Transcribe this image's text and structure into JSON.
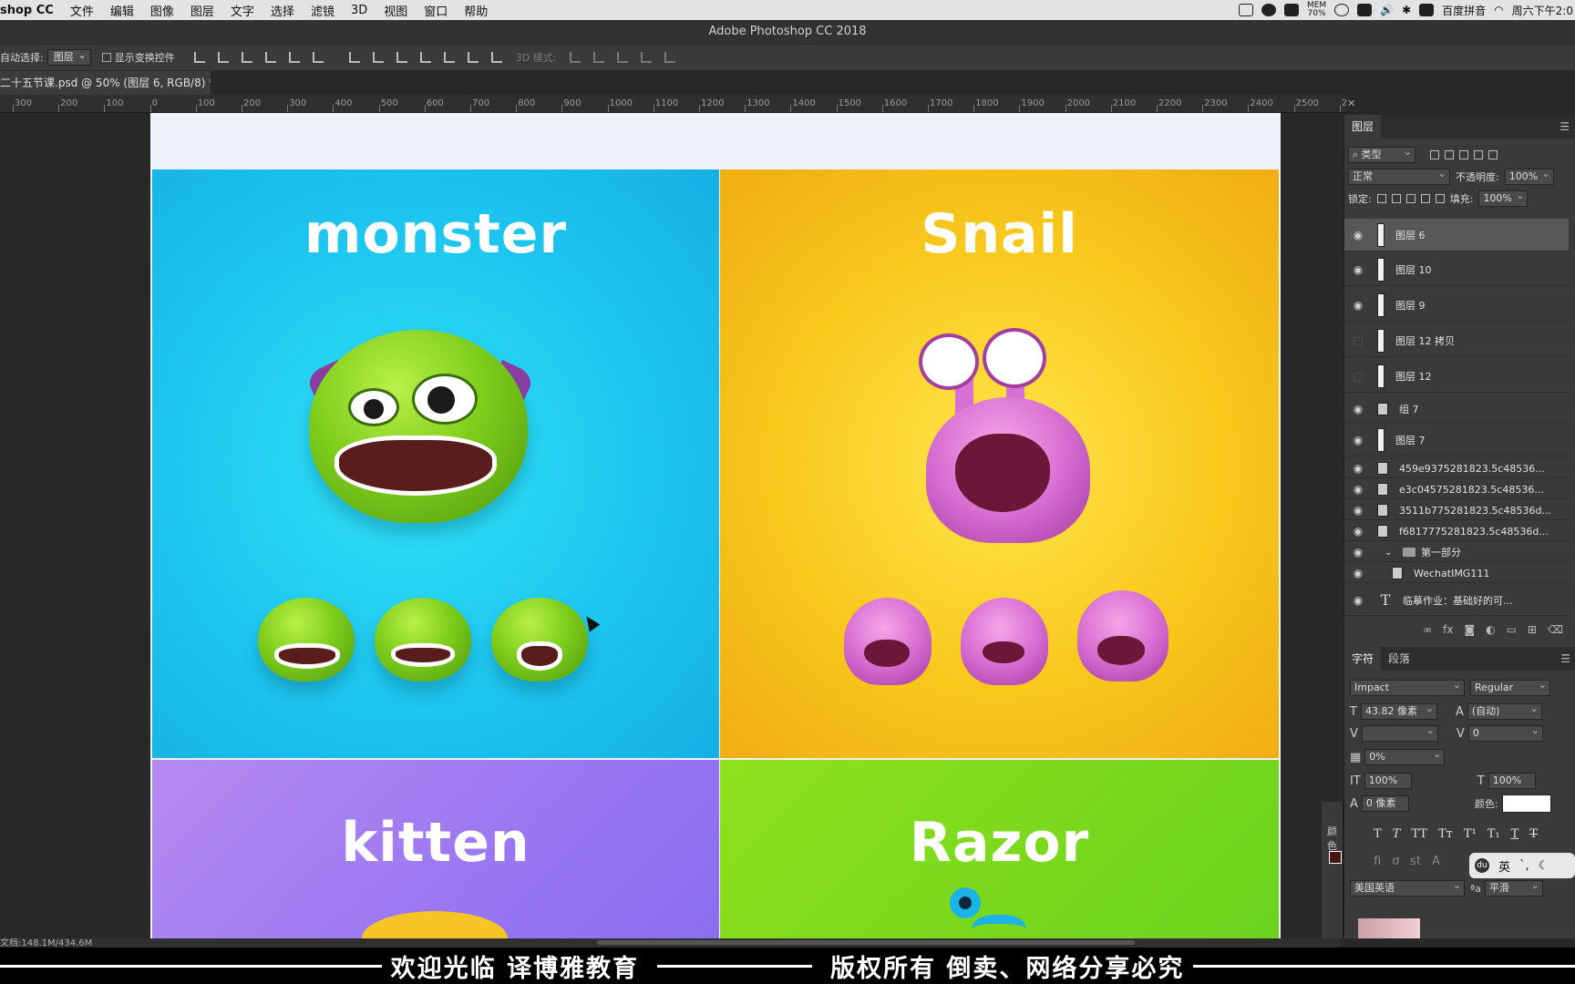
{
  "menubar": {
    "app_name": "shop CC",
    "items": [
      "文件",
      "编辑",
      "图像",
      "图层",
      "文字",
      "选择",
      "滤镜",
      "3D",
      "视图",
      "窗口",
      "帮助"
    ],
    "mem_label": "MEM",
    "mem_value": "70%",
    "input_method": "百度拼音",
    "clock": "周六下午2:0"
  },
  "titlebar": {
    "title": "Adobe Photoshop CC 2018"
  },
  "options": {
    "auto_select_label": "自动选择:",
    "auto_select_value": "图层",
    "show_transform_label": "显示变换控件",
    "mode_3d_label": "3D 模式:"
  },
  "document_tab": {
    "label": "二十五节课.psd @ 50% (图层 6, RGB/8) *"
  },
  "ruler": {
    "ticks": [
      "300",
      "200",
      "100",
      "0",
      "100",
      "200",
      "300",
      "400",
      "500",
      "600",
      "700",
      "800",
      "900",
      "1000",
      "1100",
      "1200",
      "1300",
      "1400",
      "1500",
      "1600",
      "1700",
      "1800",
      "1900",
      "2000",
      "2100",
      "2200",
      "2300",
      "2400",
      "2500",
      "2"
    ]
  },
  "canvas": {
    "panel_titles": {
      "monster": "monster",
      "snail": "Snail",
      "kitten": "kitten",
      "razor": "Razor"
    },
    "colors": {
      "blue": "#1ec6ef",
      "yellow": "#f8c81d",
      "purple": "#9a77f2",
      "green": "#6ad21e",
      "background": "#eef3fa"
    }
  },
  "status": {
    "doc_size": "文档:148.1M/434.6M"
  },
  "layers_panel": {
    "tab": "图层",
    "filter_kind": "类型",
    "blend_mode": "正常",
    "opacity_label": "不透明度:",
    "opacity_value": "100%",
    "lock_label": "锁定:",
    "fill_label": "填充:",
    "fill_value": "100%",
    "layers": [
      {
        "name": "图层 6",
        "visible": true,
        "active": true
      },
      {
        "name": "图层 10",
        "visible": true
      },
      {
        "name": "图层 9",
        "visible": true
      },
      {
        "name": "图层 12 拷贝",
        "visible": false
      },
      {
        "name": "图层 12",
        "visible": false
      },
      {
        "name": "组 7",
        "visible": true
      },
      {
        "name": "图层 7",
        "visible": true
      },
      {
        "name": "459e9375281823.5c48536...",
        "visible": true
      },
      {
        "name": "e3c04575281823.5c48536...",
        "visible": true
      },
      {
        "name": "3511b775281823.5c48536d...",
        "visible": true
      },
      {
        "name": "f6817775281823.5c48536d...",
        "visible": true
      },
      {
        "name": "第一部分",
        "visible": true
      },
      {
        "name": "WechatIMG111",
        "visible": true
      },
      {
        "name": "临摹作业：基础好的可...",
        "visible": true
      }
    ]
  },
  "character_panel": {
    "tab_char": "字符",
    "tab_para": "段落",
    "font_family": "Impact",
    "font_style": "Regular",
    "font_size": "43.82 像素",
    "leading": "(自动)",
    "kerning": "",
    "tracking": "0",
    "tsume": "0%",
    "vertical_scale": "100%",
    "horizontal_scale": "100%",
    "baseline_shift": "0 像素",
    "color_label": "颜色:",
    "text_color": "#ffffff",
    "language": "美国英语",
    "antialias": "平滑"
  },
  "ime": {
    "label": "英"
  },
  "color_panel": {
    "label": "颜色"
  },
  "watermark": {
    "left": "欢迎光临  译博雅教育",
    "right": "版权所有  倒卖、网络分享必究"
  }
}
